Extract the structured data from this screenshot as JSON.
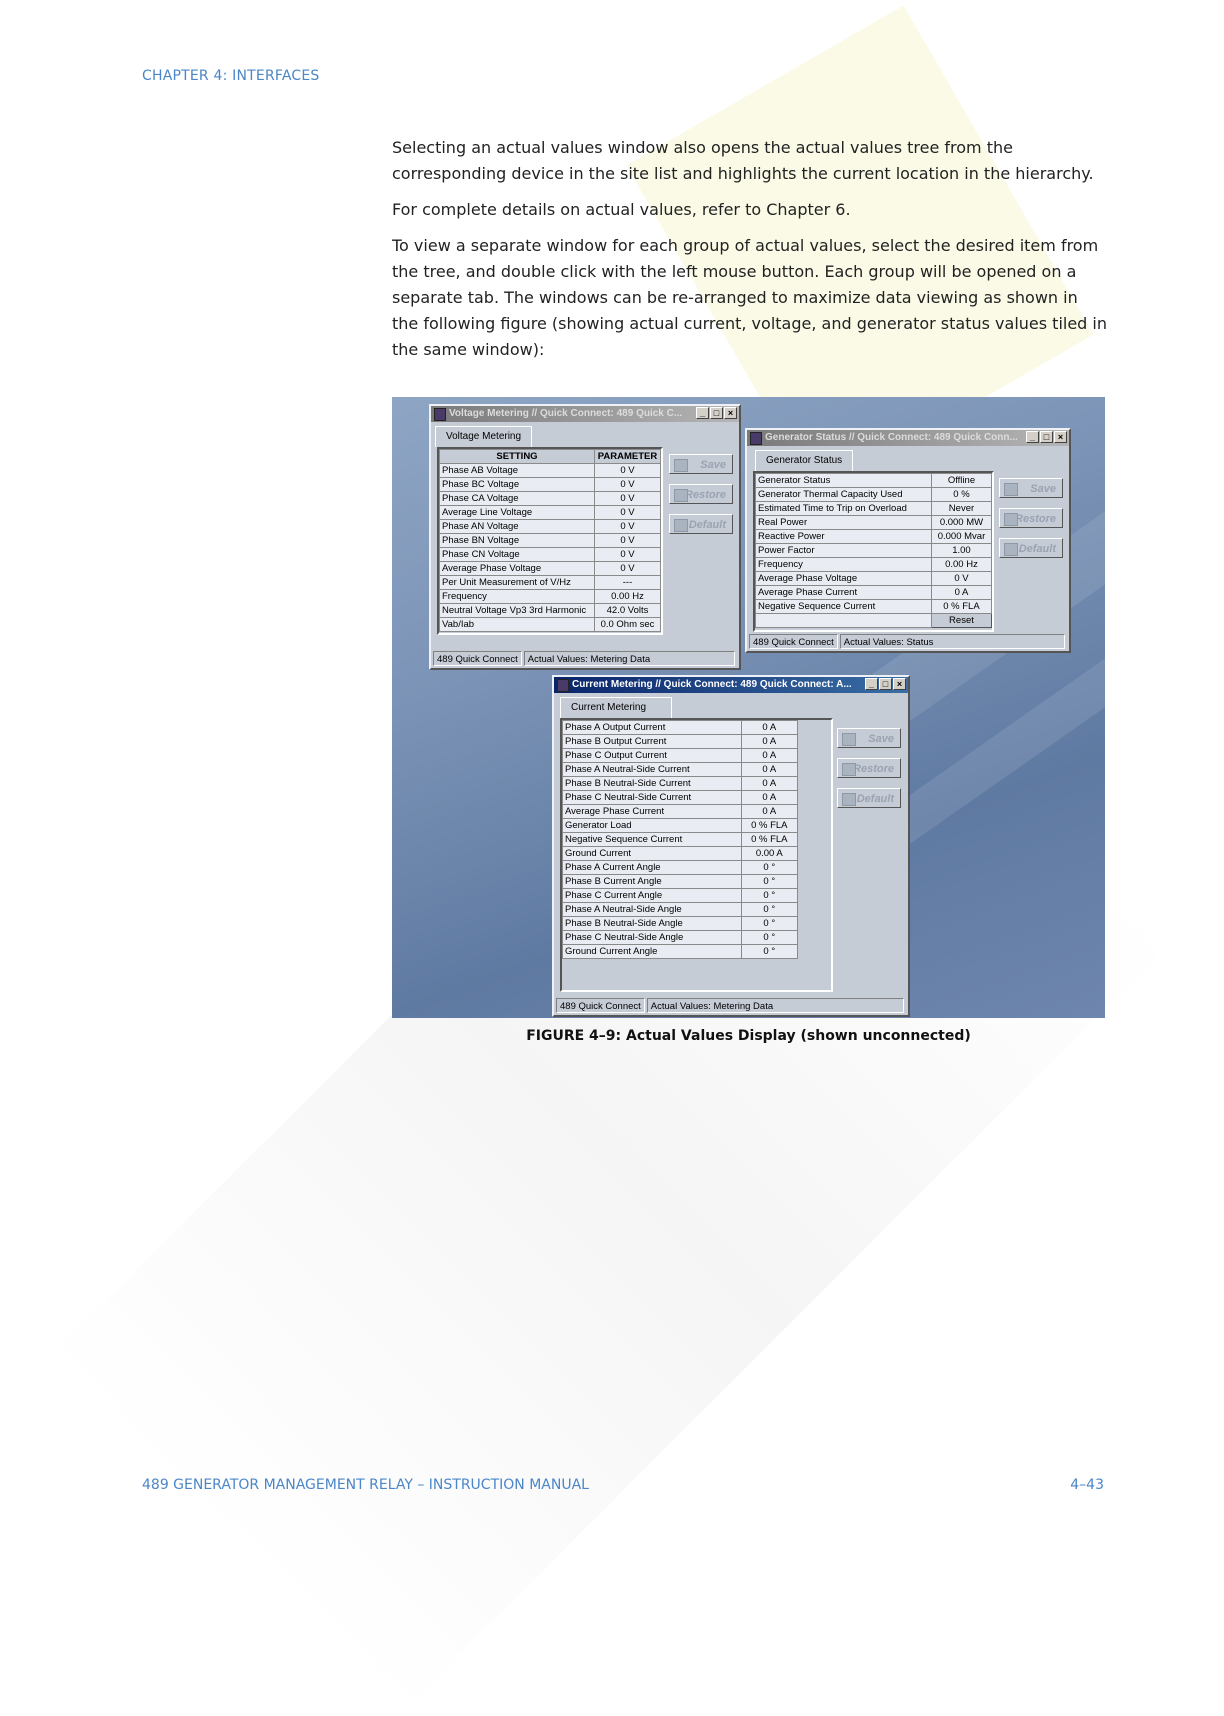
{
  "header": {
    "chapter": "CHAPTER 4: INTERFACES"
  },
  "body": {
    "p1": "Selecting an actual values window also opens the actual values tree from the corresponding device in the site list and highlights the current location in the hierarchy.",
    "p2": "For complete details on actual values, refer to Chapter 6.",
    "p3": "To view a separate window for each group of actual values, select the desired item from the tree, and double click with the left mouse button. Each group will be opened on a separate tab. The windows can be re-arranged to maximize data viewing as shown in the following figure (showing actual current, voltage, and generator status values tiled in the same window):"
  },
  "figure": {
    "caption": "FIGURE 4–9: Actual Values Display (shown unconnected)",
    "buttons": {
      "save": "Save",
      "restore": "Restore",
      "default": "Default",
      "reset": "Reset"
    },
    "title_buttons": {
      "min": "_",
      "max": "□",
      "close": "×"
    },
    "voltage": {
      "title": "Voltage Metering // Quick Connect: 489 Quick C...",
      "tab": "Voltage Metering",
      "col_setting": "SETTING",
      "col_parameter": "PARAMETER",
      "rows": [
        [
          "Phase AB Voltage",
          "0 V"
        ],
        [
          "Phase BC Voltage",
          "0 V"
        ],
        [
          "Phase CA Voltage",
          "0 V"
        ],
        [
          "Average Line Voltage",
          "0 V"
        ],
        [
          "Phase AN Voltage",
          "0 V"
        ],
        [
          "Phase BN Voltage",
          "0 V"
        ],
        [
          "Phase CN Voltage",
          "0 V"
        ],
        [
          "Average Phase Voltage",
          "0 V"
        ],
        [
          "Per Unit Measurement of V/Hz",
          "---"
        ],
        [
          "Frequency",
          "0.00 Hz"
        ],
        [
          "Neutral Voltage Vp3 3rd Harmonic",
          "42.0 Volts"
        ],
        [
          "Vab/Iab",
          "0.0 Ohm sec"
        ]
      ],
      "status_left": "489 Quick Connect",
      "status_right": "Actual Values: Metering Data"
    },
    "generator": {
      "title": "Generator Status // Quick Connect: 489 Quick Conn...",
      "tab": "Generator Status",
      "rows": [
        [
          "Generator Status",
          "Offline"
        ],
        [
          "Generator Thermal Capacity Used",
          "0 %"
        ],
        [
          "Estimated Time to Trip on Overload",
          "Never"
        ],
        [
          "Real Power",
          "0.000 MW"
        ],
        [
          "Reactive Power",
          "0.000 Mvar"
        ],
        [
          "Power Factor",
          "1.00"
        ],
        [
          "Frequency",
          "0.00 Hz"
        ],
        [
          "Average Phase Voltage",
          "0 V"
        ],
        [
          "Average Phase Current",
          "0 A"
        ],
        [
          "Negative Sequence Current",
          "0 % FLA"
        ]
      ],
      "status_left": "489 Quick Connect",
      "status_right": "Actual Values: Status"
    },
    "current": {
      "title": "Current Metering // Quick Connect: 489 Quick Connect: A...",
      "tab": "Current Metering",
      "rows": [
        [
          "Phase A Output Current",
          "0 A"
        ],
        [
          "Phase B Output Current",
          "0 A"
        ],
        [
          "Phase C Output Current",
          "0 A"
        ],
        [
          "Phase A Neutral-Side Current",
          "0 A"
        ],
        [
          "Phase B Neutral-Side Current",
          "0 A"
        ],
        [
          "Phase C Neutral-Side Current",
          "0 A"
        ],
        [
          "Average Phase Current",
          "0 A"
        ],
        [
          "Generator Load",
          "0 % FLA"
        ],
        [
          "Negative Sequence Current",
          "0 % FLA"
        ],
        [
          "Ground Current",
          "0.00 A"
        ],
        [
          "Phase A Current Angle",
          "0 °"
        ],
        [
          "Phase B Current Angle",
          "0 °"
        ],
        [
          "Phase C Current Angle",
          "0 °"
        ],
        [
          "Phase A  Neutral-Side Angle",
          "0 °"
        ],
        [
          "Phase B  Neutral-Side Angle",
          "0 °"
        ],
        [
          "Phase C  Neutral-Side Angle",
          "0 °"
        ],
        [
          "Ground Current Angle",
          "0 °"
        ]
      ],
      "status_left": "489 Quick Connect",
      "status_right": "Actual Values: Metering Data"
    }
  },
  "footer": {
    "left": "489 GENERATOR MANAGEMENT RELAY – INSTRUCTION MANUAL",
    "right": "4–43"
  }
}
